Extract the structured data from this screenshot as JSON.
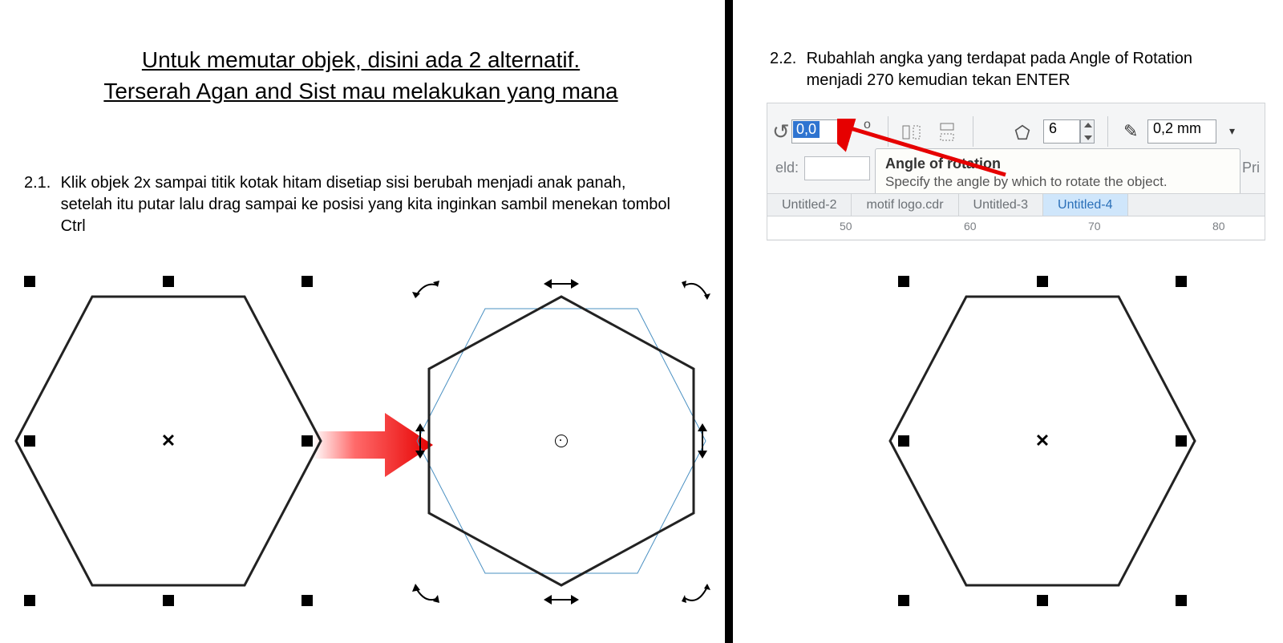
{
  "title_line1": "Untuk memutar objek, disini ada 2 alternatif.",
  "title_line2": "Terserah Agan and Sist mau melakukan yang mana",
  "step21": {
    "num": "2.1.",
    "text": "Klik objek 2x sampai titik kotak hitam disetiap sisi berubah menjadi anak panah, setelah itu putar lalu drag sampai ke posisi yang kita inginkan sambil menekan tombol Ctrl"
  },
  "step22": {
    "num": "2.2.",
    "text": "Rubahlah angka yang terdapat pada Angle of Rotation menjadi 270 kemudian tekan ENTER"
  },
  "toolbar": {
    "angle_value": "0,0",
    "degree": "o",
    "sides_value": "6",
    "outline_value": "0,2 mm",
    "eld_label": "eld:",
    "pri_label": "Pri",
    "tooltip_title": "Angle of rotation",
    "tooltip_desc": "Specify the angle by which to rotate the object.",
    "tabs": {
      "t1": "Untitled-2",
      "t2": "motif logo.cdr",
      "t3": "Untitled-3",
      "t4": "Untitled-4"
    },
    "ruler": {
      "r50": "50",
      "r60": "60",
      "r70": "70",
      "r80": "80"
    }
  },
  "glyphs": {
    "center_x": "✕"
  }
}
